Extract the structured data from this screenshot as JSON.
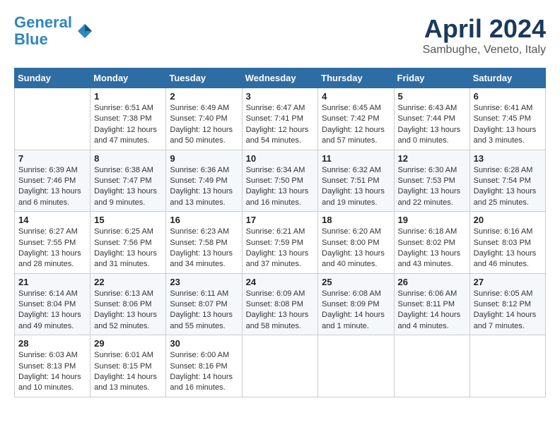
{
  "header": {
    "logo_line1": "General",
    "logo_line2": "Blue",
    "month_title": "April 2024",
    "subtitle": "Sambughe, Veneto, Italy"
  },
  "weekdays": [
    "Sunday",
    "Monday",
    "Tuesday",
    "Wednesday",
    "Thursday",
    "Friday",
    "Saturday"
  ],
  "weeks": [
    [
      {
        "day": "",
        "info": ""
      },
      {
        "day": "1",
        "info": "Sunrise: 6:51 AM\nSunset: 7:38 PM\nDaylight: 12 hours\nand 47 minutes."
      },
      {
        "day": "2",
        "info": "Sunrise: 6:49 AM\nSunset: 7:40 PM\nDaylight: 12 hours\nand 50 minutes."
      },
      {
        "day": "3",
        "info": "Sunrise: 6:47 AM\nSunset: 7:41 PM\nDaylight: 12 hours\nand 54 minutes."
      },
      {
        "day": "4",
        "info": "Sunrise: 6:45 AM\nSunset: 7:42 PM\nDaylight: 12 hours\nand 57 minutes."
      },
      {
        "day": "5",
        "info": "Sunrise: 6:43 AM\nSunset: 7:44 PM\nDaylight: 13 hours\nand 0 minutes."
      },
      {
        "day": "6",
        "info": "Sunrise: 6:41 AM\nSunset: 7:45 PM\nDaylight: 13 hours\nand 3 minutes."
      }
    ],
    [
      {
        "day": "7",
        "info": "Sunrise: 6:39 AM\nSunset: 7:46 PM\nDaylight: 13 hours\nand 6 minutes."
      },
      {
        "day": "8",
        "info": "Sunrise: 6:38 AM\nSunset: 7:47 PM\nDaylight: 13 hours\nand 9 minutes."
      },
      {
        "day": "9",
        "info": "Sunrise: 6:36 AM\nSunset: 7:49 PM\nDaylight: 13 hours\nand 13 minutes."
      },
      {
        "day": "10",
        "info": "Sunrise: 6:34 AM\nSunset: 7:50 PM\nDaylight: 13 hours\nand 16 minutes."
      },
      {
        "day": "11",
        "info": "Sunrise: 6:32 AM\nSunset: 7:51 PM\nDaylight: 13 hours\nand 19 minutes."
      },
      {
        "day": "12",
        "info": "Sunrise: 6:30 AM\nSunset: 7:53 PM\nDaylight: 13 hours\nand 22 minutes."
      },
      {
        "day": "13",
        "info": "Sunrise: 6:28 AM\nSunset: 7:54 PM\nDaylight: 13 hours\nand 25 minutes."
      }
    ],
    [
      {
        "day": "14",
        "info": "Sunrise: 6:27 AM\nSunset: 7:55 PM\nDaylight: 13 hours\nand 28 minutes."
      },
      {
        "day": "15",
        "info": "Sunrise: 6:25 AM\nSunset: 7:56 PM\nDaylight: 13 hours\nand 31 minutes."
      },
      {
        "day": "16",
        "info": "Sunrise: 6:23 AM\nSunset: 7:58 PM\nDaylight: 13 hours\nand 34 minutes."
      },
      {
        "day": "17",
        "info": "Sunrise: 6:21 AM\nSunset: 7:59 PM\nDaylight: 13 hours\nand 37 minutes."
      },
      {
        "day": "18",
        "info": "Sunrise: 6:20 AM\nSunset: 8:00 PM\nDaylight: 13 hours\nand 40 minutes."
      },
      {
        "day": "19",
        "info": "Sunrise: 6:18 AM\nSunset: 8:02 PM\nDaylight: 13 hours\nand 43 minutes."
      },
      {
        "day": "20",
        "info": "Sunrise: 6:16 AM\nSunset: 8:03 PM\nDaylight: 13 hours\nand 46 minutes."
      }
    ],
    [
      {
        "day": "21",
        "info": "Sunrise: 6:14 AM\nSunset: 8:04 PM\nDaylight: 13 hours\nand 49 minutes."
      },
      {
        "day": "22",
        "info": "Sunrise: 6:13 AM\nSunset: 8:06 PM\nDaylight: 13 hours\nand 52 minutes."
      },
      {
        "day": "23",
        "info": "Sunrise: 6:11 AM\nSunset: 8:07 PM\nDaylight: 13 hours\nand 55 minutes."
      },
      {
        "day": "24",
        "info": "Sunrise: 6:09 AM\nSunset: 8:08 PM\nDaylight: 13 hours\nand 58 minutes."
      },
      {
        "day": "25",
        "info": "Sunrise: 6:08 AM\nSunset: 8:09 PM\nDaylight: 14 hours\nand 1 minute."
      },
      {
        "day": "26",
        "info": "Sunrise: 6:06 AM\nSunset: 8:11 PM\nDaylight: 14 hours\nand 4 minutes."
      },
      {
        "day": "27",
        "info": "Sunrise: 6:05 AM\nSunset: 8:12 PM\nDaylight: 14 hours\nand 7 minutes."
      }
    ],
    [
      {
        "day": "28",
        "info": "Sunrise: 6:03 AM\nSunset: 8:13 PM\nDaylight: 14 hours\nand 10 minutes."
      },
      {
        "day": "29",
        "info": "Sunrise: 6:01 AM\nSunset: 8:15 PM\nDaylight: 14 hours\nand 13 minutes."
      },
      {
        "day": "30",
        "info": "Sunrise: 6:00 AM\nSunset: 8:16 PM\nDaylight: 14 hours\nand 16 minutes."
      },
      {
        "day": "",
        "info": ""
      },
      {
        "day": "",
        "info": ""
      },
      {
        "day": "",
        "info": ""
      },
      {
        "day": "",
        "info": ""
      }
    ]
  ]
}
